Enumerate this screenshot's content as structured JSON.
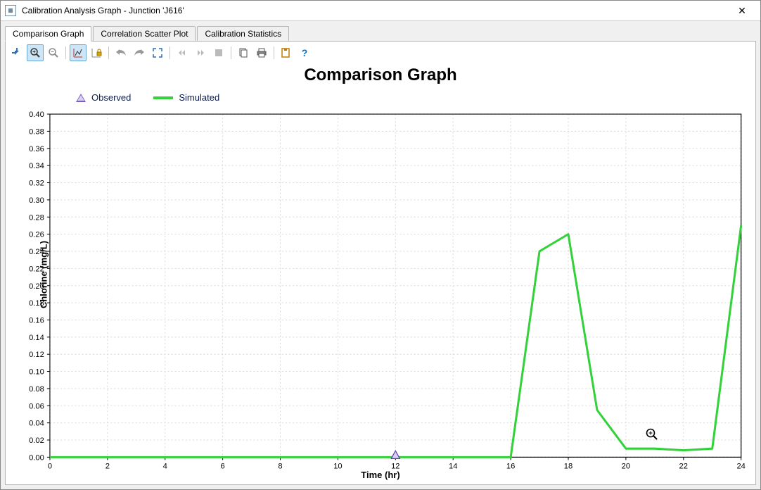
{
  "window": {
    "title": "Calibration Analysis Graph - Junction 'J616'",
    "close_label": "Close"
  },
  "tabs": [
    {
      "label": "Comparison Graph",
      "active": true
    },
    {
      "label": "Correlation Scatter Plot",
      "active": false
    },
    {
      "label": "Calibration Statistics",
      "active": false
    }
  ],
  "toolbar": {
    "pan": "Pan",
    "zoom_in": "Zoom In",
    "zoom_out": "Zoom Out",
    "axis_lock_y": "Dynamic Y-axis",
    "axis_lock_x": "Fixed Y-axis",
    "undo": "Unzoom",
    "redo": "Redo",
    "extents": "Zoom Extents",
    "scroll_left": "Scroll Left",
    "scroll_right": "Scroll Right",
    "stop": "Stop",
    "copy": "Copy",
    "print": "Print",
    "options": "Options",
    "help": "Help"
  },
  "chart": {
    "title": "Comparison Graph",
    "xlabel": "Time (hr)",
    "ylabel": "Chlorine (mg/L)"
  },
  "legend": {
    "observed": "Observed",
    "simulated": "Simulated"
  },
  "chart_data": {
    "type": "line",
    "title": "Comparison Graph",
    "xlabel": "Time (hr)",
    "ylabel": "Chlorine (mg/L)",
    "xlim": [
      0,
      24
    ],
    "ylim": [
      0,
      0.4
    ],
    "x_ticks": [
      0,
      2,
      4,
      6,
      8,
      10,
      12,
      14,
      16,
      18,
      20,
      22,
      24
    ],
    "y_ticks": [
      0.0,
      0.02,
      0.04,
      0.06,
      0.08,
      0.1,
      0.12,
      0.14,
      0.16,
      0.18,
      0.2,
      0.22,
      0.24,
      0.26,
      0.28,
      0.3,
      0.32,
      0.34,
      0.36,
      0.38,
      0.4
    ],
    "series": [
      {
        "name": "Simulated",
        "color": "#33d13a",
        "x": [
          0,
          2,
          4,
          6,
          8,
          10,
          12,
          14,
          16,
          17,
          18,
          19,
          20,
          21,
          22,
          23,
          24
        ],
        "y": [
          0.0,
          0.0,
          0.0,
          0.0,
          0.0,
          0.0,
          0.0,
          0.0,
          0.0,
          0.24,
          0.26,
          0.055,
          0.01,
          0.01,
          0.008,
          0.01,
          0.27
        ]
      },
      {
        "name": "Observed",
        "color": "#7a5cc6",
        "marker": "triangle",
        "x": [
          12
        ],
        "y": [
          0.0
        ]
      }
    ],
    "legend_position": "top-left",
    "grid": true
  }
}
